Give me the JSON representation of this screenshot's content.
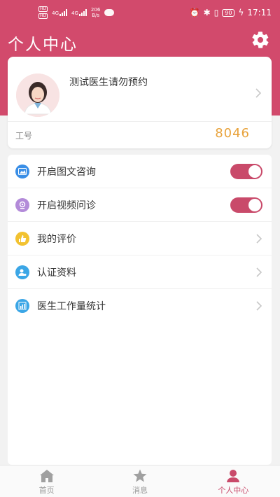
{
  "status_bar": {
    "sim1": "HD",
    "sim2": "HD",
    "net1": "4G",
    "net2": "4G",
    "speed_value": "206",
    "speed_unit": "B/s",
    "battery": "90",
    "time": "17:11"
  },
  "header": {
    "title": "个人中心",
    "settings_icon": "gear-icon"
  },
  "profile": {
    "name": "测试医生请勿预约",
    "id_label": "工号",
    "id_value": "8046"
  },
  "menu": {
    "items": [
      {
        "label": "开启图文咨询",
        "icon": "image-chat-icon",
        "icon_color": "#3a8ee6",
        "control": "toggle",
        "on": true
      },
      {
        "label": "开启视频问诊",
        "icon": "video-consult-icon",
        "icon_color": "#b38bd9",
        "control": "toggle",
        "on": true
      },
      {
        "label": "我的评价",
        "icon": "thumb-up-icon",
        "icon_color": "#f2c230",
        "control": "chevron"
      },
      {
        "label": "认证资料",
        "icon": "user-id-icon",
        "icon_color": "#3ba6e6",
        "control": "chevron"
      },
      {
        "label": "医生工作量统计",
        "icon": "bar-chart-icon",
        "icon_color": "#3ba6e6",
        "control": "chevron"
      }
    ]
  },
  "tabbar": {
    "tabs": [
      {
        "label": "首页",
        "icon": "home-icon",
        "active": false
      },
      {
        "label": "消息",
        "icon": "star-icon",
        "active": false
      },
      {
        "label": "个人中心",
        "icon": "person-icon",
        "active": true
      }
    ]
  },
  "colors": {
    "brand": "#d24a6c",
    "toggle_on": "#c94a6a",
    "id_value": "#e8a23a"
  }
}
